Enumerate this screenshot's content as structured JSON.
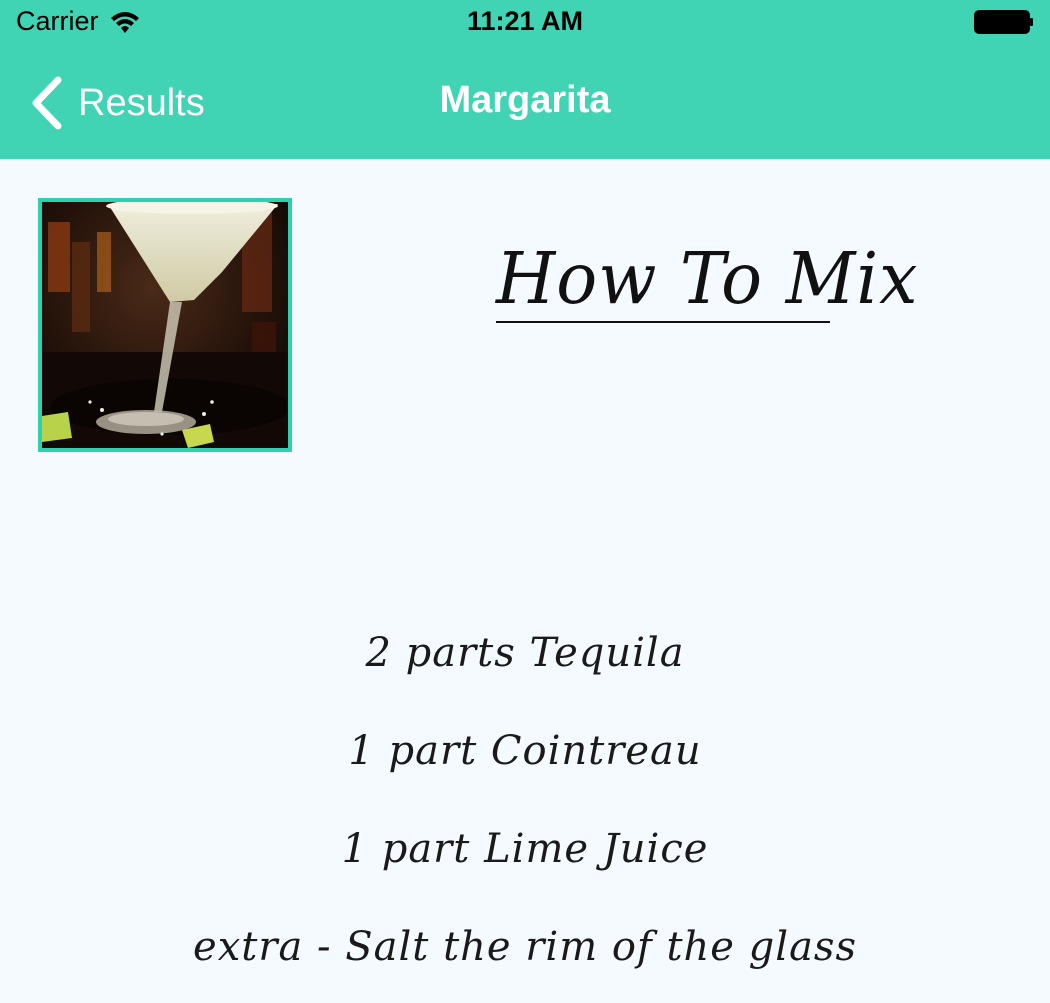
{
  "status_bar": {
    "carrier": "Carrier",
    "time": "11:21 AM",
    "icons": [
      "wifi-icon",
      "battery-icon"
    ]
  },
  "nav_bar": {
    "back_label": "Results",
    "back_icon": "chevron-left-icon",
    "title": "Margarita",
    "background_color": "#40d3b4"
  },
  "recipe": {
    "image_subject": "margarita-cocktail-photo",
    "section_title": "How To Mix",
    "ingredients": [
      "2 parts Tequila",
      "1 part Cointreau",
      "1 part Lime Juice",
      "extra -  Salt the rim of the glass"
    ]
  },
  "colors": {
    "accent": "#40d3b4",
    "image_border": "#2dd1ad",
    "page_background": "#f4faff"
  }
}
